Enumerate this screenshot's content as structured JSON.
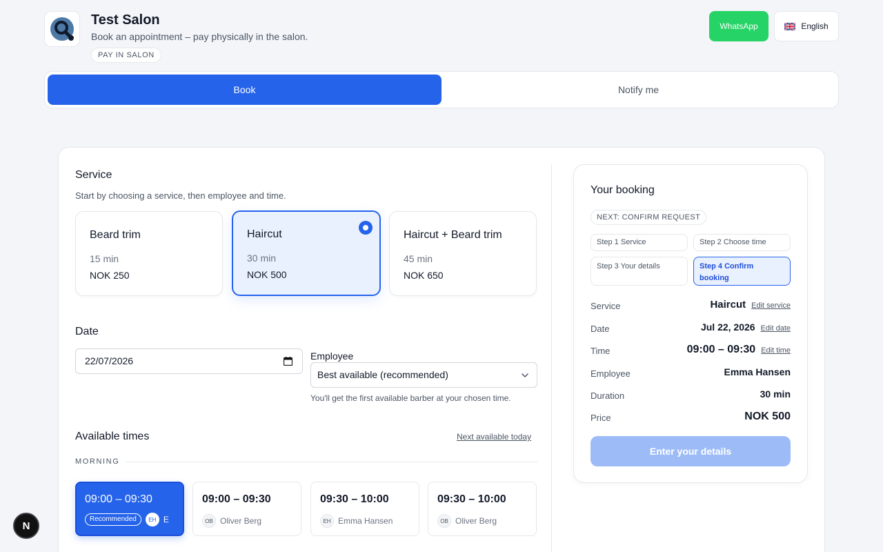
{
  "header": {
    "salon_name": "Test Salon",
    "subtitle": "Book an appointment – pay physically in the salon.",
    "pay_badge": "PAY IN SALON",
    "whatsapp_label": "WhatsApp",
    "language_label": "English"
  },
  "tabs": [
    {
      "label": "Book",
      "active": true
    },
    {
      "label": "Notify me",
      "active": false
    }
  ],
  "service": {
    "title": "Service",
    "subtitle": "Start by choosing a service, then employee and time.",
    "items": [
      {
        "name": "Beard trim",
        "duration": "15 min",
        "price": "NOK 250",
        "selected": false
      },
      {
        "name": "Haircut",
        "duration": "30 min",
        "price": "NOK 500",
        "selected": true
      },
      {
        "name": "Haircut + Beard trim",
        "duration": "45 min",
        "price": "NOK 650",
        "selected": false
      }
    ]
  },
  "date": {
    "title": "Date",
    "value": "22/07/2026"
  },
  "employee": {
    "label": "Employee",
    "selected": "Best available (recommended)",
    "hint": "You'll get the first available barber at your chosen time."
  },
  "times": {
    "title": "Available times",
    "next_link": "Next available today",
    "morning_label": "MORNING",
    "recommended_label": "Recommended",
    "slots": [
      {
        "time": "09:00 – 09:30",
        "initials": "EH",
        "employee": "E",
        "selected": true
      },
      {
        "time": "09:00 – 09:30",
        "initials": "OB",
        "employee": "Oliver Berg",
        "selected": false
      },
      {
        "time": "09:30 – 10:00",
        "initials": "EH",
        "employee": "Emma Hansen",
        "selected": false
      },
      {
        "time": "09:30 – 10:00",
        "initials": "OB",
        "employee": "Oliver Berg",
        "selected": false
      }
    ]
  },
  "summary": {
    "title": "Your booking",
    "next_badge": "NEXT: CONFIRM REQUEST",
    "steps": [
      {
        "label": "Step 1 Service",
        "active": false
      },
      {
        "label": "Step 2 Choose time",
        "active": false
      },
      {
        "label": "Step 3 Your details",
        "active": false
      },
      {
        "label": "Step 4 Confirm booking",
        "active": true
      }
    ],
    "rows": {
      "service": {
        "label": "Service",
        "value": "Haircut",
        "link": "Edit service"
      },
      "date": {
        "label": "Date",
        "value": "Jul 22, 2026",
        "link": "Edit date"
      },
      "time": {
        "label": "Time",
        "value": "09:00 – 09:30",
        "link": "Edit time"
      },
      "employee": {
        "label": "Employee",
        "value": "Emma Hansen"
      },
      "duration": {
        "label": "Duration",
        "value": "30 min"
      },
      "price": {
        "label": "Price",
        "value": "NOK 500"
      }
    },
    "button_label": "Enter your details"
  },
  "floating": {
    "label": "N"
  },
  "colors": {
    "accent": "#2563eb",
    "whatsapp": "#25d366",
    "selected_bg": "#eaf1fe",
    "disabled_button": "#9dbcf7"
  },
  "icons": {
    "logo": "search-icon",
    "language": "uk-flag-icon",
    "date": "calendar-icon",
    "employee_select": "chevron-down-icon"
  }
}
